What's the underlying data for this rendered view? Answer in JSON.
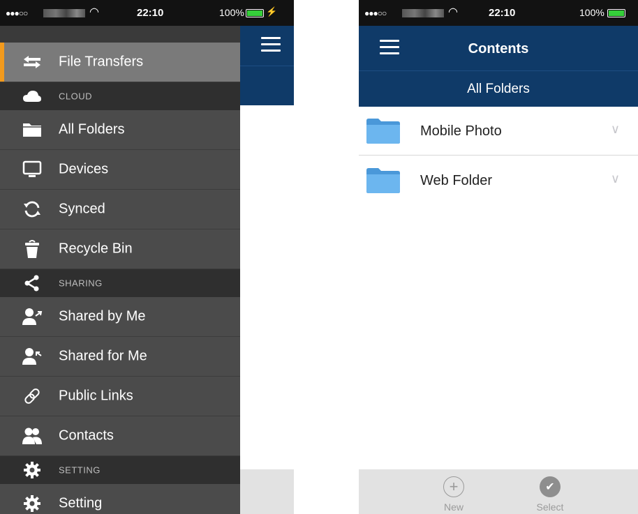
{
  "status": {
    "signal": "●●●○○",
    "time": "22:10",
    "battery": "100%"
  },
  "drawer": {
    "items": [
      {
        "kind": "item",
        "label": "File Transfers",
        "icon": "transfer-icon",
        "active": true
      },
      {
        "kind": "section",
        "label": "CLOUD",
        "icon": "cloud-icon"
      },
      {
        "kind": "item",
        "label": "All Folders",
        "icon": "folder-icon"
      },
      {
        "kind": "item",
        "label": "Devices",
        "icon": "monitor-icon"
      },
      {
        "kind": "item",
        "label": "Synced",
        "icon": "sync-icon"
      },
      {
        "kind": "item",
        "label": "Recycle Bin",
        "icon": "trash-icon"
      },
      {
        "kind": "section",
        "label": "SHARING",
        "icon": "share-icon"
      },
      {
        "kind": "item",
        "label": "Shared by Me",
        "icon": "user-share-out-icon"
      },
      {
        "kind": "item",
        "label": "Shared for Me",
        "icon": "user-share-in-icon"
      },
      {
        "kind": "item",
        "label": "Public Links",
        "icon": "link-icon"
      },
      {
        "kind": "item",
        "label": "Contacts",
        "icon": "contacts-icon"
      },
      {
        "kind": "section",
        "label": "SETTING",
        "icon": "gear-icon"
      },
      {
        "kind": "item",
        "label": "Setting",
        "icon": "gear-icon"
      }
    ]
  },
  "contents": {
    "title": "Contents",
    "subtitle": "All Folders",
    "folders": [
      {
        "name": "Mobile Photo"
      },
      {
        "name": "Web Folder"
      }
    ],
    "toolbar": {
      "new_label": "New",
      "select_label": "Select"
    }
  },
  "colors": {
    "navy": "#0f3a68",
    "drawer": "#4b4b4b",
    "section": "#2f2f2f",
    "active": "#7a7a7a",
    "accent": "#f29a1d",
    "folder": "#5aa9e8"
  }
}
